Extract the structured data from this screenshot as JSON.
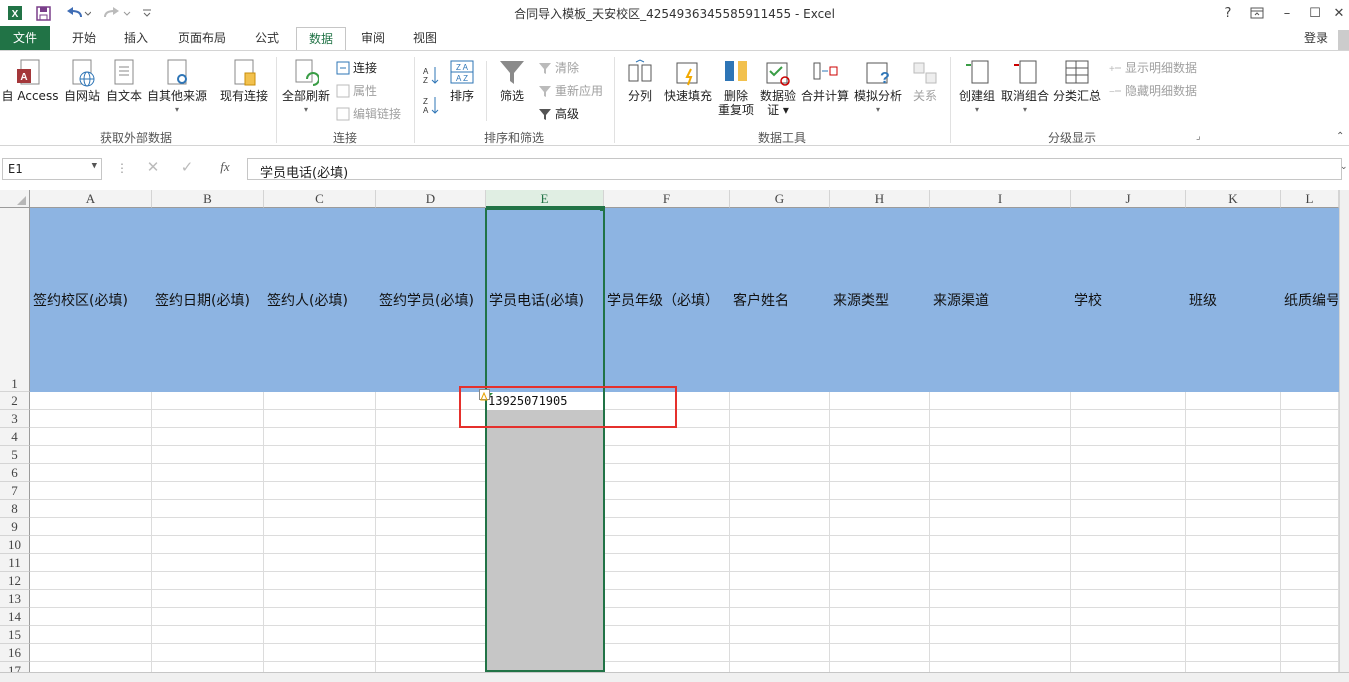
{
  "window": {
    "title": "合同导入模板_天安校区_4254936345585911455 - Excel",
    "controls": [
      "?",
      "▭",
      "–",
      "☐",
      "✕"
    ]
  },
  "ribbon_tabs": [
    "文件",
    "开始",
    "插入",
    "页面布局",
    "公式",
    "数据",
    "审阅",
    "视图"
  ],
  "active_tab": "数据",
  "signin": "登录",
  "groups": {
    "external": {
      "label": "获取外部数据",
      "buttons": [
        "自 Access",
        "自网站",
        "自文本",
        "自其他来源",
        "现有连接"
      ]
    },
    "connections": {
      "label": "连接",
      "refresh": "全部刷新",
      "items": [
        "连接",
        "属性",
        "编辑链接"
      ]
    },
    "sort": {
      "label": "排序和筛选",
      "sort": "排序",
      "filter": "筛选",
      "items": [
        "清除",
        "重新应用",
        "高级"
      ]
    },
    "tools": {
      "label": "数据工具",
      "buttons": [
        "分列",
        "快速填充",
        "删除\n重复项",
        "数据验\n证 ▾",
        "合并计算",
        "模拟分析",
        "关系"
      ]
    },
    "outline": {
      "label": "分级显示",
      "buttons": [
        "创建组",
        "取消组合",
        "分类汇总"
      ],
      "items": [
        "显示明细数据",
        "隐藏明细数据"
      ]
    }
  },
  "formula_bar": {
    "name_box": "E1",
    "fx": "fx",
    "value": "学员电话(必填)"
  },
  "columns": [
    "A",
    "B",
    "C",
    "D",
    "E",
    "F",
    "G",
    "H",
    "I",
    "J",
    "K",
    "L"
  ],
  "header_row": [
    "签约校区(必填)",
    "签约日期(必填)",
    "签约人(必填)",
    "签约学员(必填)",
    "学员电话(必填)",
    "学员年级（必填）",
    "客户姓名",
    "来源类型",
    "来源渠道",
    "学校",
    "班级",
    "纸质编号"
  ],
  "row_numbers": [
    "1",
    "2",
    "3",
    "4",
    "5",
    "6",
    "7",
    "8",
    "9",
    "10",
    "11",
    "12",
    "13",
    "14",
    "15",
    "16",
    "17"
  ],
  "cell_E2": "13925071905",
  "selected_column": "E",
  "colors": {
    "excel_green": "#217346",
    "header_fill": "#8db4e2",
    "selected_col_fill": "#c6c6c6",
    "highlight_box": "#e5302c"
  }
}
